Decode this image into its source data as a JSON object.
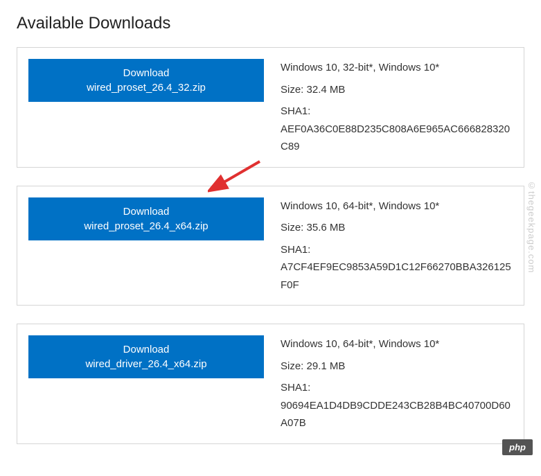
{
  "title": "Available Downloads",
  "downloads": [
    {
      "button_label": "Download",
      "filename": "wired_proset_26.4_32.zip",
      "os": "Windows 10, 32-bit*, Windows 10*",
      "size_label": "Size: 32.4 MB",
      "sha_label": "SHA1:",
      "sha_value": "AEF0A36C0E88D235C808A6E965AC666828320C89"
    },
    {
      "button_label": "Download",
      "filename": "wired_proset_26.4_x64.zip",
      "os": "Windows 10, 64-bit*, Windows 10*",
      "size_label": "Size: 35.6 MB",
      "sha_label": "SHA1:",
      "sha_value": "A7CF4EF9EC9853A59D1C12F66270BBA326125F0F"
    },
    {
      "button_label": "Download",
      "filename": "wired_driver_26.4_x64.zip",
      "os": "Windows 10, 64-bit*, Windows 10*",
      "size_label": "Size: 29.1 MB",
      "sha_label": "SHA1:",
      "sha_value": "90694EA1D4DB9CDDE243CB28B4BC40700D60A07B"
    }
  ],
  "watermark_text": "©thegeekpage.com",
  "watermark_badge": "php"
}
